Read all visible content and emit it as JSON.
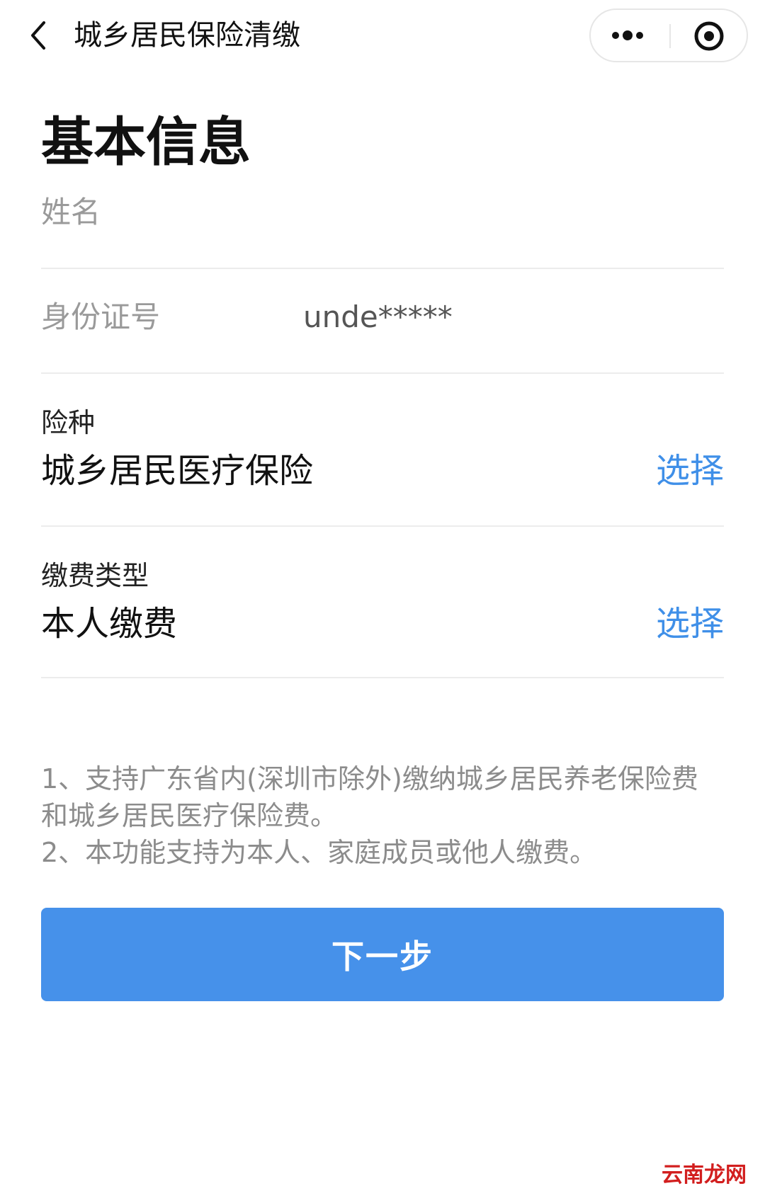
{
  "navbar": {
    "title": "城乡居民保险清缴",
    "back_icon": "chevron-left-icon",
    "more_icon": "more-dots-icon",
    "close_icon": "target-circle-icon"
  },
  "page_title": "基本信息",
  "form": {
    "name": {
      "label": "姓名",
      "value": ""
    },
    "id_number": {
      "label": "身份证号",
      "value": "unde*****"
    },
    "insurance_type": {
      "label": "险种",
      "value": "城乡居民医疗保险",
      "select_label": "选择"
    },
    "payment_type": {
      "label": "缴费类型",
      "value": "本人缴费",
      "select_label": "选择"
    }
  },
  "notes": [
    "1、支持广东省内(深圳市除外)缴纳城乡居民养老保险费和城乡居民医疗保险费。",
    "2、本功能支持为本人、家庭成员或他人缴费。"
  ],
  "next_button": "下一步",
  "watermark": "云南龙网",
  "colors": {
    "accent": "#4691ea",
    "link": "#3f8fe8",
    "label_gray": "#9a9a9a"
  }
}
